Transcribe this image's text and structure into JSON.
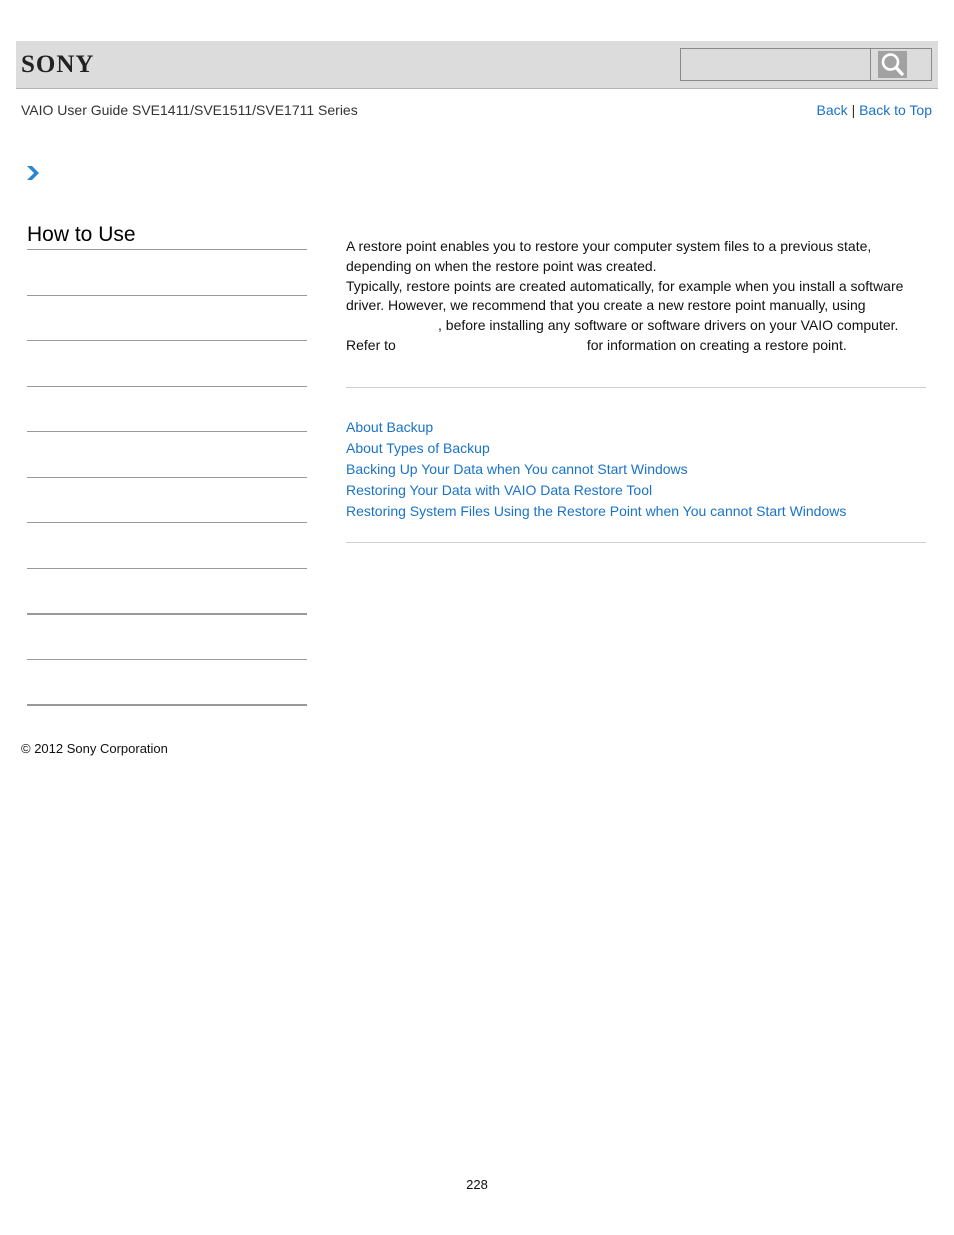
{
  "header": {
    "brand": "SONY",
    "search": {
      "placeholder": "",
      "value": "",
      "icon": "search-icon"
    }
  },
  "subheader": {
    "guide_title": "VAIO User Guide SVE1411/SVE1511/SVE1711 Series",
    "back_label": "Back",
    "separator": "|",
    "back_to_top_label": "Back to Top"
  },
  "breadcrumb": {
    "icon": "chevron-right-icon"
  },
  "sidebar": {
    "title": "How to Use",
    "items": [
      "",
      "",
      "",
      "",
      "",
      "",
      "",
      "",
      "",
      ""
    ]
  },
  "content": {
    "paragraphs": [
      "A restore point enables you to restore your computer system files to a previous state, depending on when the restore point was created.",
      "Typically, restore points are created automatically, for example when you install a software driver. However, we recommend that you create a new restore point manually, using",
      ", before installing any software or software drivers on your VAIO computer.",
      "Refer to",
      "for information on creating a restore point."
    ],
    "related_links": [
      "About Backup",
      "About Types of Backup",
      "Backing Up Your Data when You cannot Start Windows",
      "Restoring Your Data with VAIO Data Restore Tool",
      "Restoring System Files Using the Restore Point when You cannot Start Windows"
    ]
  },
  "footer": {
    "copyright": "© 2012 Sony Corporation",
    "page_number": "228"
  },
  "colors": {
    "link": "#1a73c8",
    "header_bg": "#dcdcdc",
    "chevron": "#2a86d0"
  }
}
